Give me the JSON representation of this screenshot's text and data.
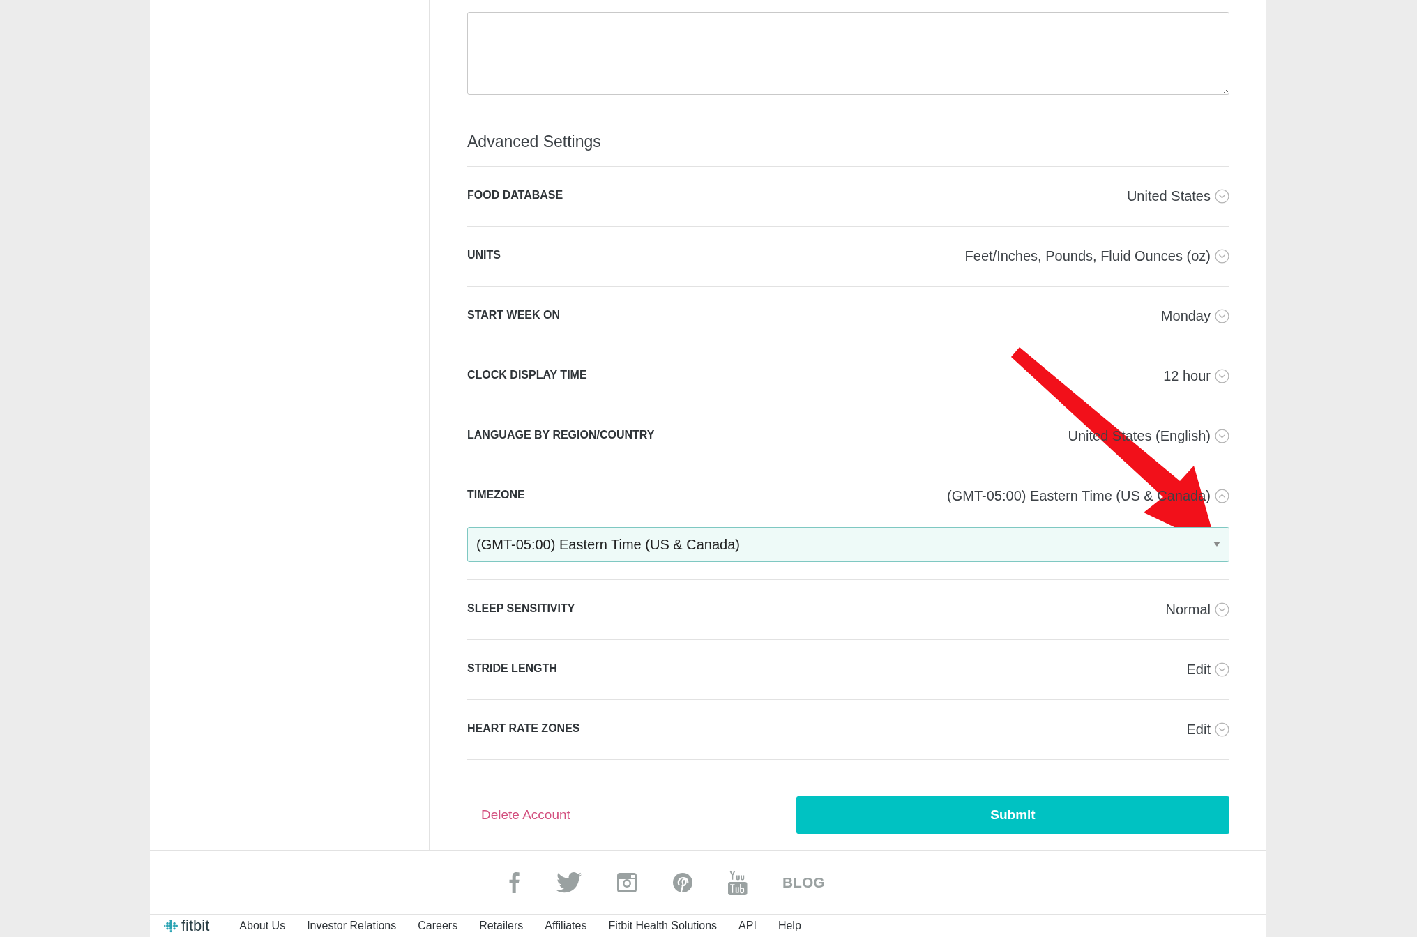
{
  "section_title": "Advanced Settings",
  "settings": [
    {
      "label": "FOOD DATABASE",
      "value": "United States",
      "expanded": false
    },
    {
      "label": "UNITS",
      "value": "Feet/Inches, Pounds, Fluid Ounces (oz)",
      "expanded": false
    },
    {
      "label": "START WEEK ON",
      "value": "Monday",
      "expanded": false
    },
    {
      "label": "CLOCK DISPLAY TIME",
      "value": "12 hour",
      "expanded": false
    },
    {
      "label": "LANGUAGE BY REGION/COUNTRY",
      "value": "United States (English)",
      "expanded": false
    },
    {
      "label": "TIMEZONE",
      "value": "(GMT-05:00) Eastern Time (US & Canada)",
      "expanded": true,
      "selected_option": "(GMT-05:00) Eastern Time (US & Canada)"
    },
    {
      "label": "SLEEP SENSITIVITY",
      "value": "Normal",
      "expanded": false
    },
    {
      "label": "STRIDE LENGTH",
      "value": "Edit",
      "expanded": false
    },
    {
      "label": "HEART RATE ZONES",
      "value": "Edit",
      "expanded": false
    }
  ],
  "delete_link": "Delete Account",
  "submit_button": "Submit",
  "blog_link": "BLOG",
  "footer": {
    "logo": "fitbit",
    "links": [
      "About Us",
      "Investor Relations",
      "Careers",
      "Retailers",
      "Affiliates",
      "Fitbit Health Solutions",
      "API",
      "Help"
    ]
  }
}
